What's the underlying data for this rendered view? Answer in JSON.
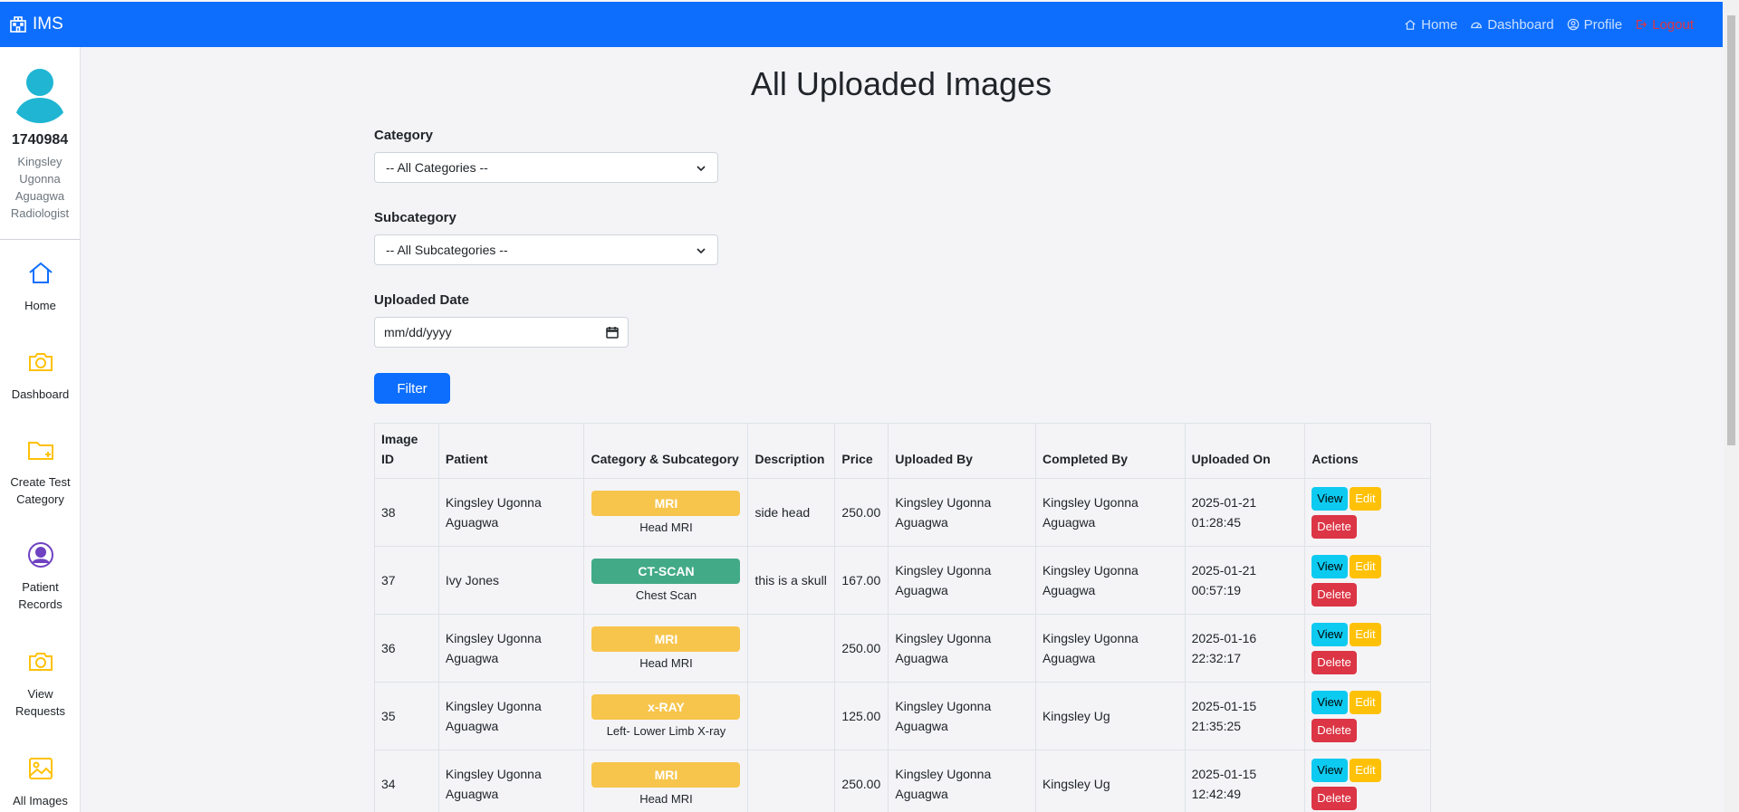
{
  "navbar": {
    "brand": "IMS",
    "links": [
      {
        "label": "Home",
        "icon": "home-icon"
      },
      {
        "label": "Dashboard",
        "icon": "dashboard-icon"
      },
      {
        "label": "Profile",
        "icon": "profile-icon"
      },
      {
        "label": "Logout",
        "icon": "logout-icon"
      }
    ]
  },
  "sidebar": {
    "user_id": "1740984",
    "user_name": "Kingsley Ugonna Aguagwa",
    "user_role": "Radiologist",
    "items": [
      {
        "label": "Home",
        "icon": "home-icon"
      },
      {
        "label": "Dashboard",
        "icon": "camera-icon"
      },
      {
        "label": "Create Test Category",
        "icon": "folder-plus-icon"
      },
      {
        "label": "Patient Records",
        "icon": "person-circle-icon"
      },
      {
        "label": "View Requests",
        "icon": "camera-icon"
      },
      {
        "label": "All Images",
        "icon": "image-icon"
      }
    ]
  },
  "main": {
    "title": "All Uploaded Images",
    "filters": {
      "category_label": "Category",
      "category_value": "-- All Categories --",
      "subcategory_label": "Subcategory",
      "subcategory_value": "-- All Subcategories --",
      "date_label": "Uploaded Date",
      "date_placeholder": "mm/dd/yyyy",
      "filter_button": "Filter"
    },
    "table": {
      "headers": [
        "Image ID",
        "Patient",
        "Category & Subcategory",
        "Description",
        "Price",
        "Uploaded By",
        "Completed By",
        "Uploaded On",
        "Actions"
      ],
      "action_labels": {
        "view": "View",
        "edit": "Edit",
        "delete": "Delete"
      },
      "rows": [
        {
          "id": "38",
          "patient": "Kingsley Ugonna Aguagwa",
          "category": "MRI",
          "subcategory": "Head MRI",
          "description": "side head",
          "price": "250.00",
          "uploaded_by": "Kingsley Ugonna Aguagwa",
          "completed_by": "Kingsley Ugonna Aguagwa",
          "uploaded_on": "2025-01-21 01:28:45"
        },
        {
          "id": "37",
          "patient": "Ivy Jones",
          "category": "CT-SCAN",
          "subcategory": "Chest Scan",
          "description": "this is a skull",
          "price": "167.00",
          "uploaded_by": "Kingsley Ugonna Aguagwa",
          "completed_by": "Kingsley Ugonna Aguagwa",
          "uploaded_on": "2025-01-21 00:57:19"
        },
        {
          "id": "36",
          "patient": "Kingsley Ugonna Aguagwa",
          "category": "MRI",
          "subcategory": "Head MRI",
          "description": "",
          "price": "250.00",
          "uploaded_by": "Kingsley Ugonna Aguagwa",
          "completed_by": "Kingsley Ugonna Aguagwa",
          "uploaded_on": "2025-01-16 22:32:17"
        },
        {
          "id": "35",
          "patient": "Kingsley Ugonna Aguagwa",
          "category": "x-RAY",
          "subcategory": "Left- Lower Limb X-ray",
          "description": "",
          "price": "125.00",
          "uploaded_by": "Kingsley Ugonna Aguagwa",
          "completed_by": "Kingsley Ug",
          "uploaded_on": "2025-01-15 21:35:25"
        },
        {
          "id": "34",
          "patient": "Kingsley Ugonna Aguagwa",
          "category": "MRI",
          "subcategory": "Head MRI",
          "description": "",
          "price": "250.00",
          "uploaded_by": "Kingsley Ugonna Aguagwa",
          "completed_by": "Kingsley Ug",
          "uploaded_on": "2025-01-15 12:42:49"
        }
      ]
    }
  },
  "colors": {
    "primary": "#0d6efd",
    "mri_badge": "#f7c54c",
    "ct_badge": "#42aa87",
    "view_button": "#0dcaf0",
    "edit_button": "#ffc107",
    "delete_button": "#dc3545"
  }
}
